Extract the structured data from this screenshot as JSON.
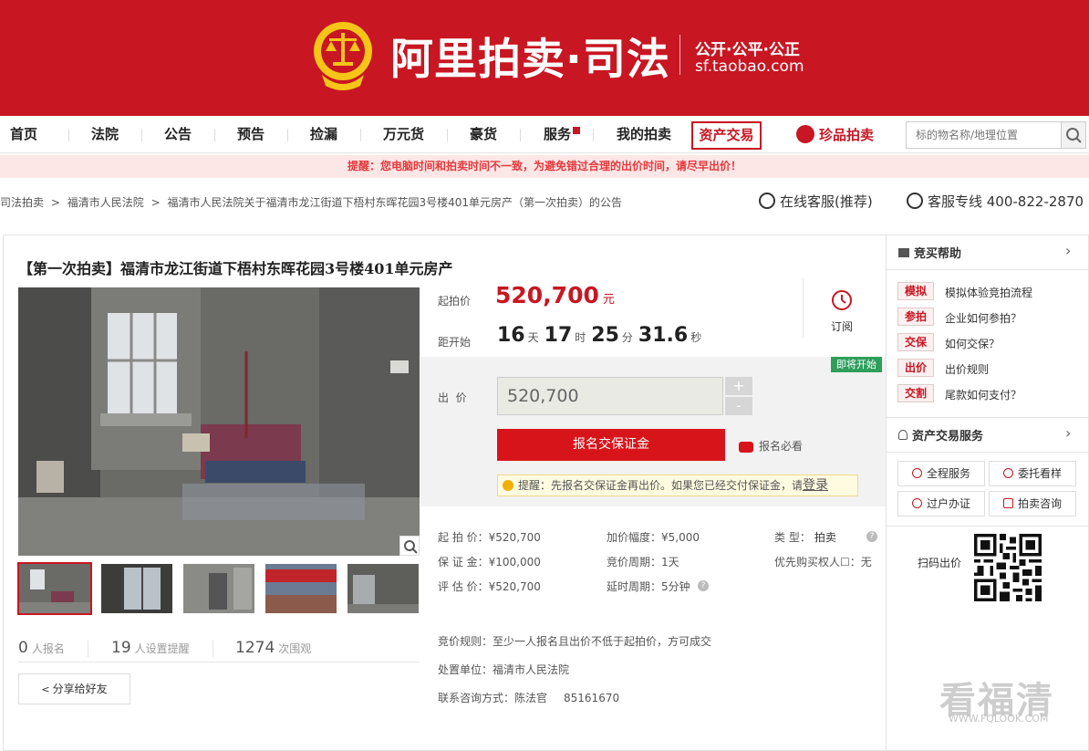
{
  "header": {
    "logo_title": "阿里拍卖·司法",
    "logo_slogan": "公开·公平·公正",
    "logo_url": "sf.taobao.com"
  },
  "nav": {
    "items": [
      "首页",
      "法院",
      "公告",
      "预告",
      "捡漏",
      "万元货",
      "豪货",
      "服务",
      "我的拍卖"
    ],
    "boxed": "资产交易",
    "treasure": "珍品拍卖",
    "search_placeholder": "标的物名称/地理位置"
  },
  "alert": "提醒：您电脑时间和拍卖时间不一致，为避免错过合理的出价时间，请尽早出价！",
  "breadcrumb": [
    "司法拍卖",
    "福清市人民法院",
    "福清市人民法院关于福清市龙江街道下梧村东晖花园3号楼401单元房产（第一次拍卖）的公告"
  ],
  "breadcrumb_sep": ">",
  "service": {
    "online": "在线客服(推荐)",
    "phone": "客服专线 400-822-2870"
  },
  "item": {
    "title": "【第一次拍卖】福清市龙江街道下梧村东晖花园3号楼401单元房产",
    "start_price_label": "起拍价",
    "start_price": "520,700",
    "currency_unit": "元",
    "countdown_label": "距开始",
    "countdown": {
      "days": "16",
      "hours": "17",
      "minutes": "25",
      "seconds": "31.6"
    },
    "countdown_units": {
      "d": "天",
      "h": "时",
      "m": "分",
      "s": "秒"
    },
    "subscribe_label": "订阅",
    "status_badge": "即将开始",
    "bid_label": "出  价",
    "bid_value": "520,700",
    "plus": "+",
    "minus": "-",
    "signup_button": "报名交保证金",
    "must_read": "报名必看",
    "tip_text": "提醒：先报名交保证金再出价。如果您已经交付保证金，请",
    "tip_link": "登录"
  },
  "details": {
    "start_price": "起 拍 价：¥520,700",
    "deposit": "保 证 金：¥100,000",
    "assessed": "评 估 价：¥520,700",
    "increment": "加价幅度：¥5,000",
    "cycle": "竞价周期：1天",
    "extension": "延时周期：5分钟",
    "type_label": "类    型：",
    "type_value": "拍卖",
    "priority": "优先购买权人",
    "priority_mark": "☐",
    "priority_value": "：无",
    "rule": "竞价规则：至少一人报名且出价不低于起拍价，方可成交",
    "unit": "处置单位：福清市人民法院",
    "contact": "联系咨询方式：陈法官",
    "contact_phone": "85161670",
    "help_mark": "?"
  },
  "stats": {
    "signups": "0",
    "signups_label": "人报名",
    "reminders": "19",
    "reminders_label": "人设置提醒",
    "views": "1274",
    "views_label": "次围观"
  },
  "share": "分享给好友",
  "sidebar": {
    "help_title": "竞买帮助",
    "help_items": [
      {
        "tag": "模拟",
        "text": "模拟体验竞拍流程"
      },
      {
        "tag": "参拍",
        "text": "企业如何参拍？"
      },
      {
        "tag": "交保",
        "text": "如何交保？"
      },
      {
        "tag": "出价",
        "text": "出价规则"
      },
      {
        "tag": "交割",
        "text": "尾款如何支付？"
      }
    ],
    "service_title": "资产交易服务",
    "services": [
      "全程服务",
      "委托看样",
      "过户办证",
      "拍卖咨询"
    ],
    "qr_label": "扫码出价",
    "chevron": "›"
  },
  "watermark": {
    "text": "看福清",
    "url": "WWW.FQLOOK.COM"
  },
  "colors": {
    "brand_red": "#c81622",
    "status_green": "#2e9f5b"
  }
}
